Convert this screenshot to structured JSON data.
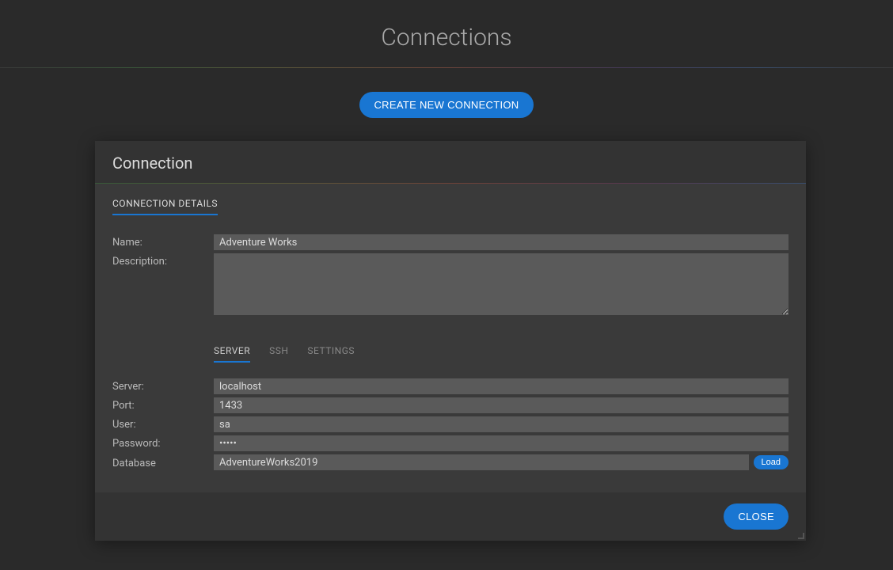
{
  "page": {
    "title": "Connections",
    "create_button": "CREATE NEW CONNECTION"
  },
  "modal": {
    "title": "Connection",
    "main_tabs": [
      {
        "label": "CONNECTION DETAILS",
        "active": true
      }
    ],
    "fields": {
      "name": {
        "label": "Name:",
        "value": "Adventure Works"
      },
      "description": {
        "label": "Description:",
        "value": ""
      }
    },
    "sub_tabs": [
      {
        "label": "SERVER",
        "active": true
      },
      {
        "label": "SSH",
        "active": false
      },
      {
        "label": "SETTINGS",
        "active": false
      }
    ],
    "server_fields": {
      "server": {
        "label": "Server:",
        "value": "localhost"
      },
      "port": {
        "label": "Port:",
        "value": "1433"
      },
      "user": {
        "label": "User:",
        "value": "sa"
      },
      "password": {
        "label": "Password:",
        "value": "•••••"
      },
      "database": {
        "label": "Database",
        "value": "AdventureWorks2019",
        "load_button": "Load"
      }
    },
    "close_button": "CLOSE"
  }
}
